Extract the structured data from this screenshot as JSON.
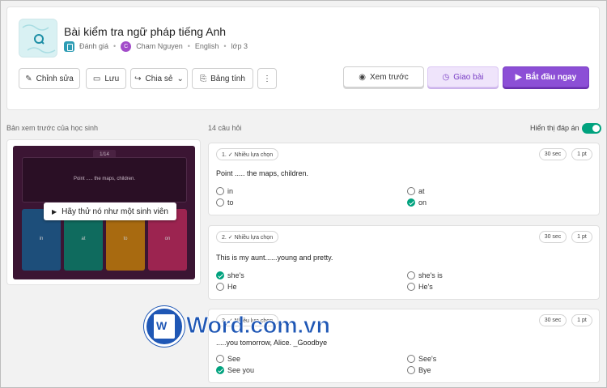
{
  "quiz": {
    "title": "Bài kiểm tra ngữ pháp tiếng Anh",
    "type": "Đánh giá",
    "author_initial": "C",
    "author": "Cham Nguyen",
    "language": "English",
    "grade": "lớp 3"
  },
  "toolbar": {
    "edit": "Chỉnh sửa",
    "save": "Lưu",
    "share": "Chia sẻ",
    "worksheet": "Bảng tính",
    "more": "⋮",
    "preview": "Xem trước",
    "assign": "Giao bài",
    "start_now": "Bắt đầu ngay"
  },
  "preview": {
    "label": "Bản xem trước của học sinh",
    "counter": "1/14",
    "question": "Point ..... the maps, children.",
    "tiles": [
      "in",
      "at",
      "to",
      "on"
    ],
    "tile_colors": [
      "#1d4e7a",
      "#0f6b5e",
      "#a86a10",
      "#9c2450"
    ],
    "try_button": "Hãy thử nó như một sinh viên"
  },
  "questions_header": {
    "count": "14 câu hỏi",
    "show_answers": "Hiển thị đáp án"
  },
  "questions": [
    {
      "tag": "1. ✓ Nhiều lựa chọn",
      "time": "30 sec",
      "points": "1 pt",
      "text": "Point ..... the maps, children.",
      "answers": [
        "in",
        "at",
        "to",
        "on"
      ],
      "correct": [
        false,
        false,
        false,
        true
      ]
    },
    {
      "tag": "2. ✓ Nhiều lựa chọn",
      "time": "30 sec",
      "points": "1 pt",
      "text": "This is my aunt......young and pretty.",
      "answers": [
        "she's",
        "she's is",
        "He",
        "He's"
      ],
      "correct": [
        true,
        false,
        false,
        false
      ]
    },
    {
      "tag": "3. ✓ Nhiều lựa chọn",
      "time": "30 sec",
      "points": "1 pt",
      "text": ".....you tomorrow, Alice. _Goodbye",
      "answers": [
        "See",
        "See's",
        "See you",
        "Bye"
      ],
      "correct": [
        false,
        false,
        true,
        false
      ]
    }
  ],
  "watermark": {
    "letter": "W",
    "text": "Word.com.vn"
  },
  "colors": {
    "accent": "#8c4fd6",
    "correct": "#00a27e",
    "watermark": "#1f57b5"
  }
}
